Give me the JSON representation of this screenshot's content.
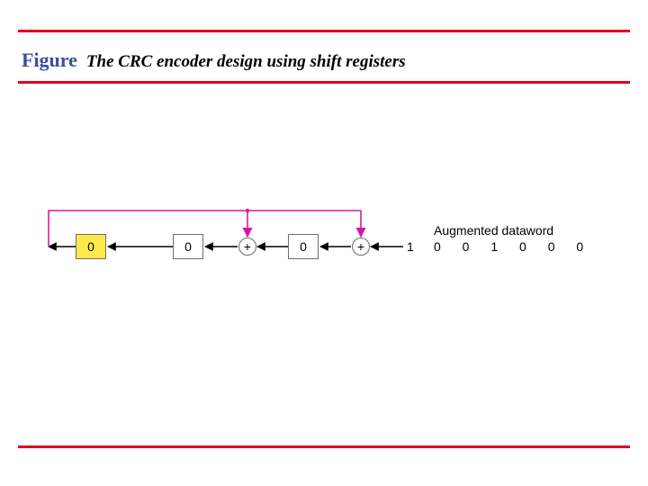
{
  "title": {
    "figure_word": "Figure",
    "caption": "The CRC encoder design using shift registers"
  },
  "diagram": {
    "registers": [
      "0",
      "0",
      "0"
    ],
    "xor_symbol": "+",
    "input_bit": "1",
    "augmented_label": "Augmented dataword",
    "augmented_bits": "0 0 1 0 0 0"
  },
  "colors": {
    "rule": "#e2001a",
    "feedback": "#d61aa0",
    "highlight": "#ffe94a"
  }
}
